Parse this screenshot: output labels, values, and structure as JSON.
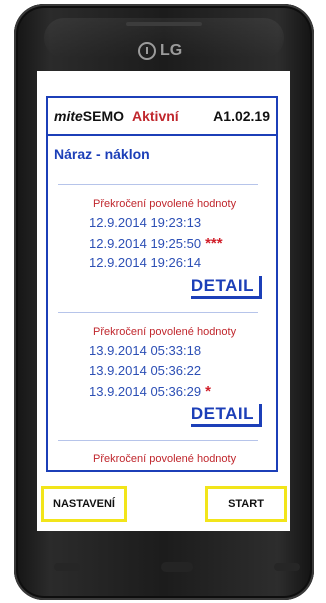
{
  "device": {
    "brand_logo": "LG"
  },
  "app": {
    "brand_prefix": "mite",
    "brand_suffix": "SEMO",
    "status": "Aktivní",
    "version": "A1.02.19"
  },
  "section": {
    "title": "Náraz - náklon"
  },
  "events": [
    {
      "title": "Překročení povolené hodnoty",
      "times": [
        {
          "text": "12.9.2014 19:23:13",
          "stars": ""
        },
        {
          "text": "12.9.2014 19:25:50",
          "stars": "***"
        },
        {
          "text": "12.9.2014 19:26:14",
          "stars": ""
        }
      ],
      "detail_label": "DETAIL"
    },
    {
      "title": "Překročení povolené hodnoty",
      "times": [
        {
          "text": "13.9.2014 05:33:18",
          "stars": ""
        },
        {
          "text": "13.9.2014 05:36:22",
          "stars": ""
        },
        {
          "text": "13.9.2014 05:36:29",
          "stars": "*"
        }
      ],
      "detail_label": "DETAIL"
    },
    {
      "title": "Překročení povolené hodnoty",
      "times": [],
      "detail_label": ""
    }
  ],
  "buttons": {
    "settings_label": "NASTAVENÍ",
    "start_label": "START"
  },
  "colors": {
    "accent_blue": "#1c3fb8",
    "alert_red": "#c0272d",
    "button_border_yellow": "#f2e51a"
  }
}
